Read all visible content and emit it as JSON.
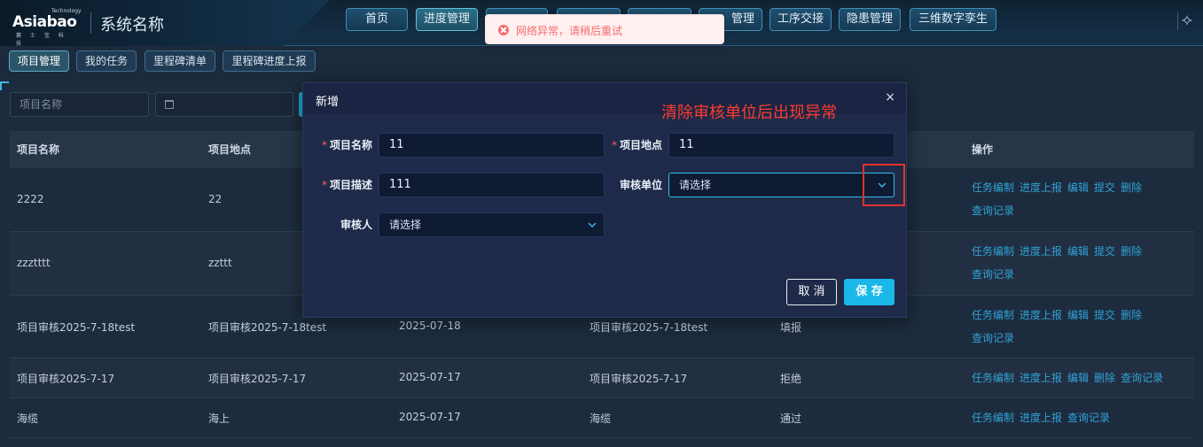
{
  "brand": {
    "logo_tech": "Technology",
    "logo_name": "Asiabao",
    "logo_sub": "赛 士 宝 科 技",
    "system_name": "系统名称"
  },
  "topnav": {
    "items": [
      "首页",
      "进度管理",
      "",
      "",
      "",
      "",
      "工序交接",
      "隐患管理",
      "三维数字孪生"
    ],
    "visible_0": "首页",
    "visible_1": "进度管理",
    "visible_6": "工序交接",
    "visible_7": "隐患管理",
    "visible_8": "三维数字孪生",
    "partial_5": "管理"
  },
  "subtabs": [
    "项目管理",
    "我的任务",
    "里程碑清单",
    "里程碑进度上报"
  ],
  "filters": {
    "project_name_placeholder": "项目名称",
    "date_icon": "calendar-icon"
  },
  "table": {
    "headers": {
      "name": "项目名称",
      "location": "项目地点",
      "ops": "操作"
    },
    "rows": [
      {
        "name": "2222",
        "location": "22",
        "date": "",
        "desc": "",
        "status": "",
        "ops": [
          "任务编制",
          "进度上报",
          "编辑",
          "提交",
          "删除",
          "查询记录"
        ]
      },
      {
        "name": "zzztttt",
        "location": "zzttt",
        "date": "",
        "desc": "",
        "status": "",
        "ops": [
          "任务编制",
          "进度上报",
          "编辑",
          "提交",
          "删除",
          "查询记录"
        ]
      },
      {
        "name": "项目审核2025-7-18test",
        "location": "项目审核2025-7-18test",
        "date": "2025-07-18",
        "desc": "项目审核2025-7-18test",
        "status": "填报",
        "ops": [
          "任务编制",
          "进度上报",
          "编辑",
          "提交",
          "删除",
          "查询记录"
        ]
      },
      {
        "name": "项目审核2025-7-17",
        "location": "项目审核2025-7-17",
        "date": "2025-07-17",
        "desc": "项目审核2025-7-17",
        "status": "拒绝",
        "ops": [
          "任务编制",
          "进度上报",
          "编辑",
          "删除",
          "查询记录"
        ]
      },
      {
        "name": "海缆",
        "location": "海上",
        "date": "2025-07-17",
        "desc": "海缆",
        "status": "通过",
        "ops": [
          "任务编制",
          "进度上报",
          "查询记录"
        ]
      }
    ]
  },
  "modal": {
    "title": "新增",
    "close": "×",
    "annotation": "清除审核单位后出现异常",
    "fields": {
      "project_name_label": "项目名称",
      "project_name_value": "11",
      "project_location_label": "项目地点",
      "project_location_value": "11",
      "project_desc_label": "项目描述",
      "project_desc_value": "111",
      "review_unit_label": "审核单位",
      "review_unit_placeholder": "请选择",
      "reviewer_label": "审核人",
      "reviewer_placeholder": "请选择",
      "required_mark": "*"
    },
    "cancel": "取 消",
    "save": "保 存"
  },
  "toast": {
    "text": "网络异常，请稍后重试"
  },
  "colors": {
    "accent": "#19b8e8",
    "link": "#2fa3d6",
    "error": "#f56c6c",
    "annotation": "#ff3b30"
  }
}
